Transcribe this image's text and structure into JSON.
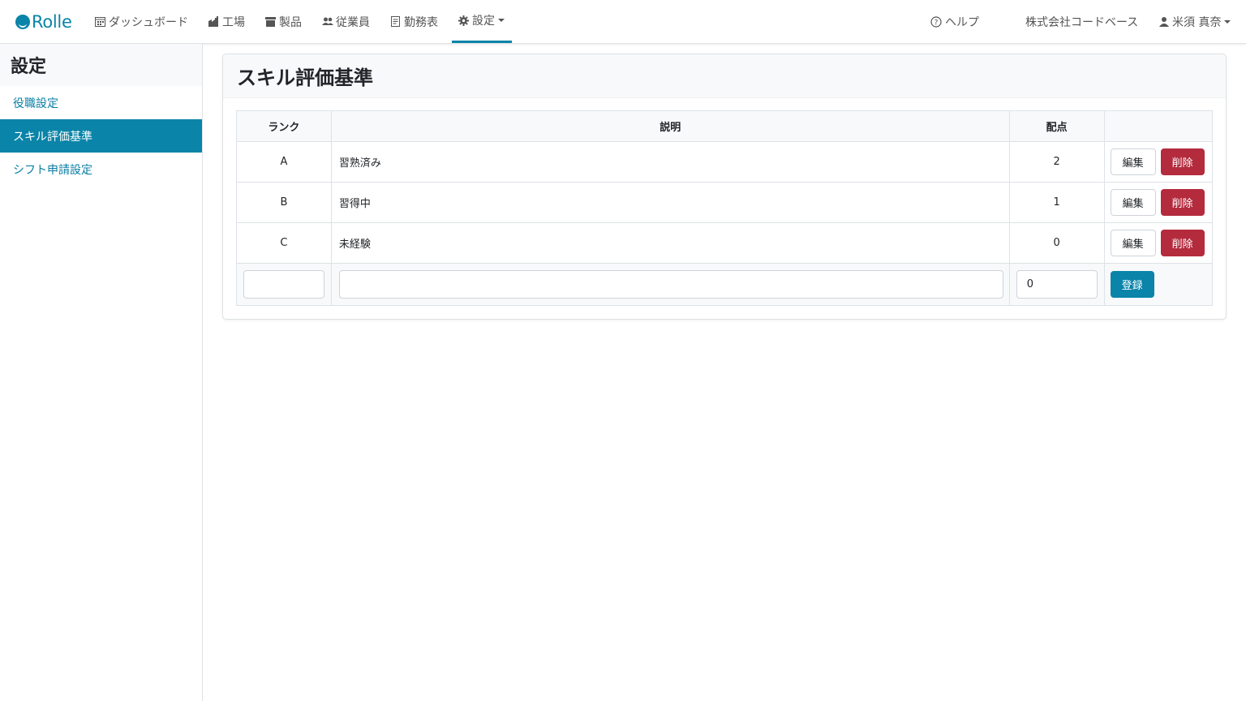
{
  "brand": {
    "name": "Rolle"
  },
  "nav": {
    "items": [
      {
        "label": "ダッシュボード",
        "icon": "calendar-icon"
      },
      {
        "label": "工場",
        "icon": "factory-icon"
      },
      {
        "label": "製品",
        "icon": "box-icon"
      },
      {
        "label": "従業員",
        "icon": "users-icon"
      },
      {
        "label": "勤務表",
        "icon": "schedule-icon"
      },
      {
        "label": "設定",
        "icon": "gear-icon",
        "active": true
      }
    ],
    "help": "ヘルプ",
    "company": "株式会社コードベース",
    "user": "米須 真奈"
  },
  "sidebar": {
    "title": "設定",
    "items": [
      {
        "label": "役職設定"
      },
      {
        "label": "スキル評価基準",
        "active": true
      },
      {
        "label": "シフト申請設定"
      }
    ]
  },
  "card": {
    "title": "スキル評価基準",
    "columns": [
      "ランク",
      "説明",
      "配点",
      ""
    ],
    "rows": [
      {
        "rank": "A",
        "description": "習熟済み",
        "score": "2"
      },
      {
        "rank": "B",
        "description": "習得中",
        "score": "1"
      },
      {
        "rank": "C",
        "description": "未経験",
        "score": "0"
      }
    ],
    "edit_label": "編集",
    "delete_label": "削除",
    "new_row": {
      "rank_value": "",
      "description_value": "",
      "score_value": "0",
      "submit_label": "登録"
    }
  },
  "colors": {
    "accent": "#0a84a8",
    "danger": "#b32b3d"
  }
}
